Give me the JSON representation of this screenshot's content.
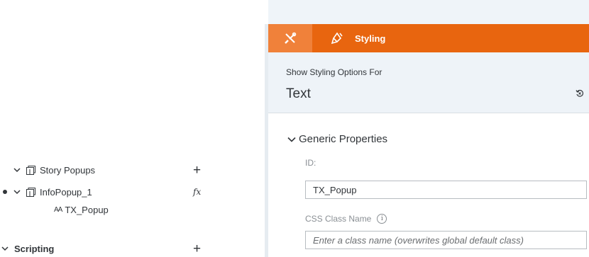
{
  "outline": {
    "rows": [
      {
        "label": "Story Popups",
        "action": "+"
      },
      {
        "label": "InfoPopup_1",
        "action": "fx"
      },
      {
        "label": "TX_Popup",
        "icon_text": "AA"
      },
      {
        "label": "Scripting",
        "action": "+"
      }
    ]
  },
  "panel": {
    "styling_label": "Styling",
    "show_for_label": "Show Styling Options For",
    "show_for_value": "Text",
    "section_title": "Generic Properties",
    "id_label": "ID:",
    "id_value": "TX_Popup",
    "css_label": "CSS Class Name",
    "info_glyph": "i",
    "css_placeholder": "Enter a class name (overwrites global default class)"
  },
  "colors": {
    "accent": "#e8650f",
    "accent_active": "#f0813a",
    "panel_bg": "#eef3f8",
    "text": "#32363a"
  }
}
